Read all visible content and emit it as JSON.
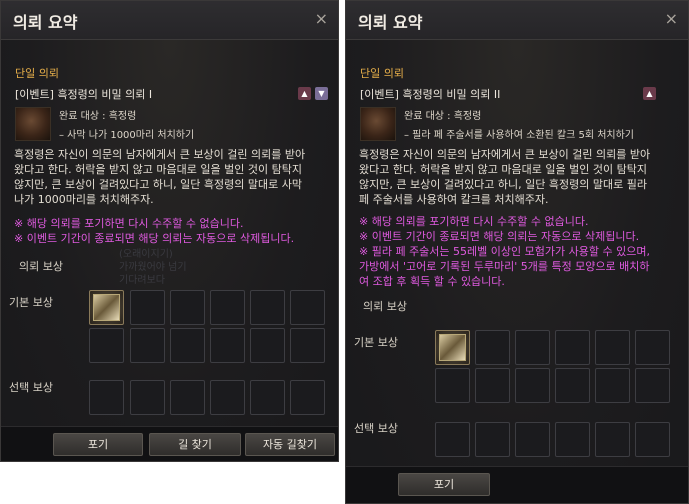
{
  "left": {
    "title": "의뢰 요약",
    "close": "×",
    "section_single": "단일 의뢰",
    "quest_name": "[이벤트] 흑정령의 비밀 의뢰 I",
    "target_label": "완료 대상 : 흑정령",
    "task": "– 사막 나가 1000마리 처치하기",
    "description": "흑정령은 자신이 의문의 남자에게서 큰 보상이 걸린 의뢰를 받아\n왔다고 한다. 허락을 받지 않고 마음대로 일을 벌인 것이 탐탁지\n않지만, 큰 보상이 걸려있다고 하니, 일단 흑정령의 말대로 사막\n나가 1000마리를 처치해주자.",
    "warnings": "※ 해당 의뢰를 포기하면 다시 수주할 수 없습니다.\n※ 이벤트 기간이 종료되면 해당 의뢰는 자동으로 삭제됩니다.",
    "reward_title": "의뢰 보상",
    "basic_reward": "기본 보상",
    "optional_reward": "선택 보상",
    "buttons": {
      "give_up": "포기",
      "find_path": "길 찾기",
      "auto_path": "자동 길찾기"
    }
  },
  "right": {
    "title": "의뢰 요약",
    "close": "×",
    "section_single": "단일 의뢰",
    "quest_name": "[이벤트] 흑정령의 비밀 의뢰 II",
    "target_label": "완료 대상 : 흑정령",
    "task": "– 필라 페 주술서를 사용하여 소환된 칼크 5회 처치하기",
    "description": "흑정령은 자신이 의문의 남자에게서 큰 보상이 걸린 의뢰를 받아\n왔다고 한다. 허락을 받지 않고 마음대로 일을 벌인 것이 탐탁지\n않지만, 큰 보상이 걸려있다고 하니, 일단 흑정령의 말대로 필라\n페 주술서를 사용하여 칼크를 처치해주자.",
    "warnings": "※ 해당 의뢰를 포기하면 다시 수주할 수 없습니다.\n※ 이벤트 기간이 종료되면 해당 의뢰는 자동으로 삭제됩니다.\n※ 필라 페 주술서는 55레벨 이상인 모험가가 사용할 수 있으며,\n가방에서 '고어로 기록된 두루마리' 5개를 특정 모양으로 배치하\n여 조합 후 획득 할 수 있습니다.",
    "reward_title": "의뢰 보상",
    "basic_reward": "기본 보상",
    "optional_reward": "선택 보상",
    "buttons": {
      "give_up": "포기"
    }
  },
  "icons": {
    "up": "▲",
    "down": "▼"
  },
  "colors": {
    "section": "#e8b04a",
    "warning": "#e05ae0",
    "background": "#1c1c20"
  }
}
